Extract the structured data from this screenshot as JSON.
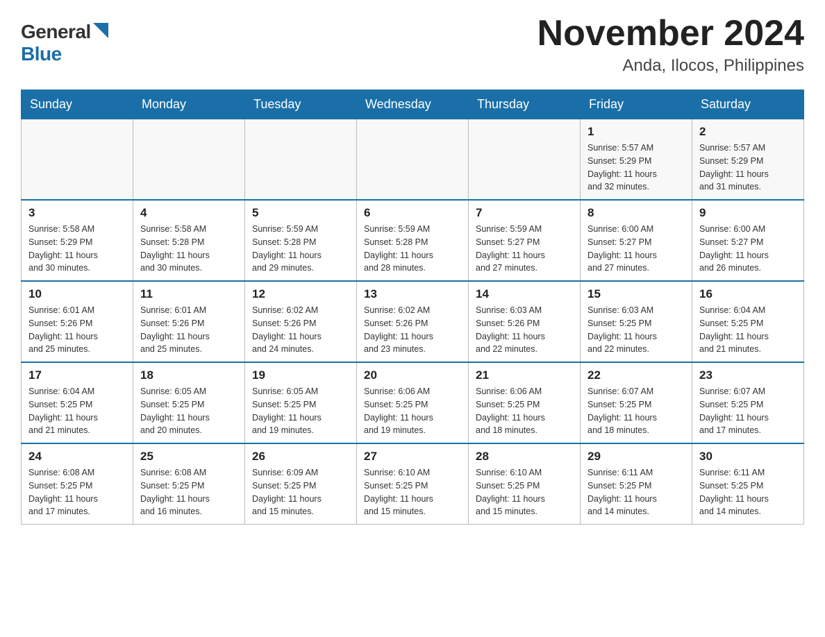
{
  "logo": {
    "general": "General",
    "blue": "Blue"
  },
  "title": "November 2024",
  "subtitle": "Anda, Ilocos, Philippines",
  "weekdays": [
    "Sunday",
    "Monday",
    "Tuesday",
    "Wednesday",
    "Thursday",
    "Friday",
    "Saturday"
  ],
  "weeks": [
    [
      {
        "day": "",
        "info": ""
      },
      {
        "day": "",
        "info": ""
      },
      {
        "day": "",
        "info": ""
      },
      {
        "day": "",
        "info": ""
      },
      {
        "day": "",
        "info": ""
      },
      {
        "day": "1",
        "info": "Sunrise: 5:57 AM\nSunset: 5:29 PM\nDaylight: 11 hours\nand 32 minutes."
      },
      {
        "day": "2",
        "info": "Sunrise: 5:57 AM\nSunset: 5:29 PM\nDaylight: 11 hours\nand 31 minutes."
      }
    ],
    [
      {
        "day": "3",
        "info": "Sunrise: 5:58 AM\nSunset: 5:29 PM\nDaylight: 11 hours\nand 30 minutes."
      },
      {
        "day": "4",
        "info": "Sunrise: 5:58 AM\nSunset: 5:28 PM\nDaylight: 11 hours\nand 30 minutes."
      },
      {
        "day": "5",
        "info": "Sunrise: 5:59 AM\nSunset: 5:28 PM\nDaylight: 11 hours\nand 29 minutes."
      },
      {
        "day": "6",
        "info": "Sunrise: 5:59 AM\nSunset: 5:28 PM\nDaylight: 11 hours\nand 28 minutes."
      },
      {
        "day": "7",
        "info": "Sunrise: 5:59 AM\nSunset: 5:27 PM\nDaylight: 11 hours\nand 27 minutes."
      },
      {
        "day": "8",
        "info": "Sunrise: 6:00 AM\nSunset: 5:27 PM\nDaylight: 11 hours\nand 27 minutes."
      },
      {
        "day": "9",
        "info": "Sunrise: 6:00 AM\nSunset: 5:27 PM\nDaylight: 11 hours\nand 26 minutes."
      }
    ],
    [
      {
        "day": "10",
        "info": "Sunrise: 6:01 AM\nSunset: 5:26 PM\nDaylight: 11 hours\nand 25 minutes."
      },
      {
        "day": "11",
        "info": "Sunrise: 6:01 AM\nSunset: 5:26 PM\nDaylight: 11 hours\nand 25 minutes."
      },
      {
        "day": "12",
        "info": "Sunrise: 6:02 AM\nSunset: 5:26 PM\nDaylight: 11 hours\nand 24 minutes."
      },
      {
        "day": "13",
        "info": "Sunrise: 6:02 AM\nSunset: 5:26 PM\nDaylight: 11 hours\nand 23 minutes."
      },
      {
        "day": "14",
        "info": "Sunrise: 6:03 AM\nSunset: 5:26 PM\nDaylight: 11 hours\nand 22 minutes."
      },
      {
        "day": "15",
        "info": "Sunrise: 6:03 AM\nSunset: 5:25 PM\nDaylight: 11 hours\nand 22 minutes."
      },
      {
        "day": "16",
        "info": "Sunrise: 6:04 AM\nSunset: 5:25 PM\nDaylight: 11 hours\nand 21 minutes."
      }
    ],
    [
      {
        "day": "17",
        "info": "Sunrise: 6:04 AM\nSunset: 5:25 PM\nDaylight: 11 hours\nand 21 minutes."
      },
      {
        "day": "18",
        "info": "Sunrise: 6:05 AM\nSunset: 5:25 PM\nDaylight: 11 hours\nand 20 minutes."
      },
      {
        "day": "19",
        "info": "Sunrise: 6:05 AM\nSunset: 5:25 PM\nDaylight: 11 hours\nand 19 minutes."
      },
      {
        "day": "20",
        "info": "Sunrise: 6:06 AM\nSunset: 5:25 PM\nDaylight: 11 hours\nand 19 minutes."
      },
      {
        "day": "21",
        "info": "Sunrise: 6:06 AM\nSunset: 5:25 PM\nDaylight: 11 hours\nand 18 minutes."
      },
      {
        "day": "22",
        "info": "Sunrise: 6:07 AM\nSunset: 5:25 PM\nDaylight: 11 hours\nand 18 minutes."
      },
      {
        "day": "23",
        "info": "Sunrise: 6:07 AM\nSunset: 5:25 PM\nDaylight: 11 hours\nand 17 minutes."
      }
    ],
    [
      {
        "day": "24",
        "info": "Sunrise: 6:08 AM\nSunset: 5:25 PM\nDaylight: 11 hours\nand 17 minutes."
      },
      {
        "day": "25",
        "info": "Sunrise: 6:08 AM\nSunset: 5:25 PM\nDaylight: 11 hours\nand 16 minutes."
      },
      {
        "day": "26",
        "info": "Sunrise: 6:09 AM\nSunset: 5:25 PM\nDaylight: 11 hours\nand 15 minutes."
      },
      {
        "day": "27",
        "info": "Sunrise: 6:10 AM\nSunset: 5:25 PM\nDaylight: 11 hours\nand 15 minutes."
      },
      {
        "day": "28",
        "info": "Sunrise: 6:10 AM\nSunset: 5:25 PM\nDaylight: 11 hours\nand 15 minutes."
      },
      {
        "day": "29",
        "info": "Sunrise: 6:11 AM\nSunset: 5:25 PM\nDaylight: 11 hours\nand 14 minutes."
      },
      {
        "day": "30",
        "info": "Sunrise: 6:11 AM\nSunset: 5:25 PM\nDaylight: 11 hours\nand 14 minutes."
      }
    ]
  ]
}
